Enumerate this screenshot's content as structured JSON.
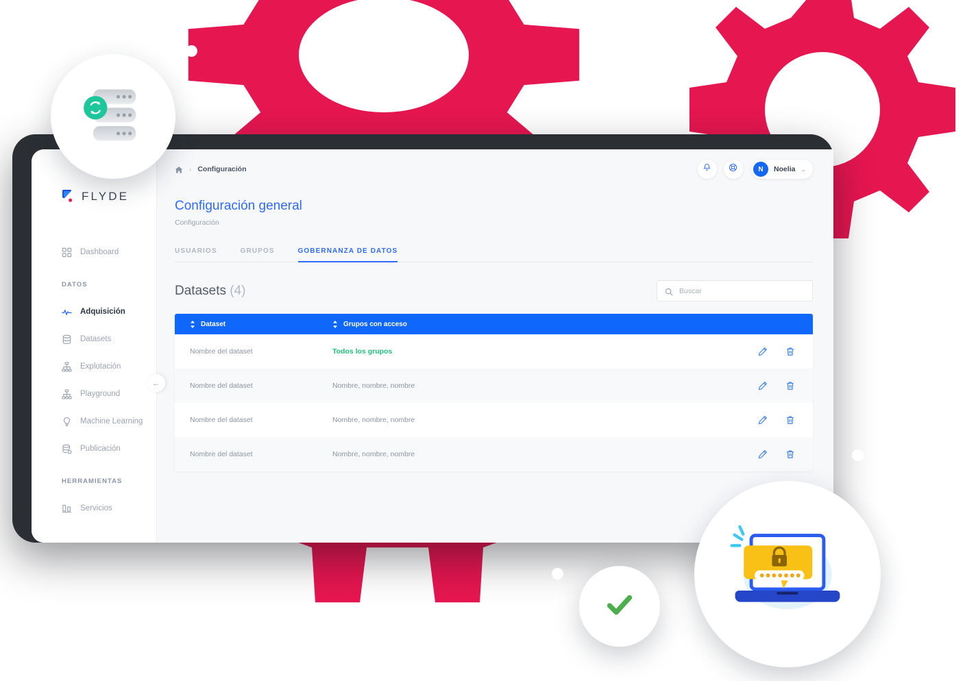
{
  "brand": {
    "name": "FLYDE",
    "accent_blue": "#2f6bff",
    "accent_pink": "#e61650",
    "accent_green": "#22c07a",
    "header_blue": "#0f67fb"
  },
  "sidebar": {
    "logo_label": "FLYDE",
    "items": [
      {
        "label": "Dashboard",
        "icon": "grid-icon",
        "active": false
      },
      {
        "label": "Adquisición",
        "icon": "pulse-icon",
        "active": true
      },
      {
        "label": "Datasets",
        "icon": "database-icon",
        "active": false
      },
      {
        "label": "Explotación",
        "icon": "sitemap-icon",
        "active": false
      },
      {
        "label": "Playground",
        "icon": "sitemap-icon",
        "active": false
      },
      {
        "label": "Machine Learning",
        "icon": "bulb-icon",
        "active": false
      },
      {
        "label": "Publicación",
        "icon": "database-upload-icon",
        "active": false
      },
      {
        "label": "Servicios",
        "icon": "columns-icon",
        "active": false
      }
    ],
    "section_datos": "DATOS",
    "section_herramientas": "HERRAMIENTAS",
    "collapse_label": "←"
  },
  "topbar": {
    "breadcrumb_home": "home-icon",
    "breadcrumb_separator": "›",
    "breadcrumb_current": "Configuración",
    "notifications_icon": "bell-icon",
    "help_icon": "lifebuoy-icon",
    "user_initial": "N",
    "user_name": "Noelia",
    "user_chevron": "⌄"
  },
  "page": {
    "title": "Configuración general",
    "subtitle": "Configuración"
  },
  "tabs": [
    {
      "label": "USUARIOS",
      "active": false
    },
    {
      "label": "GRUPOS",
      "active": false
    },
    {
      "label": "GOBERNANZA DE DATOS",
      "active": true
    }
  ],
  "section": {
    "title": "Datasets",
    "count": "(4)"
  },
  "search": {
    "placeholder": "Buscar",
    "value": "",
    "icon": "search-icon"
  },
  "table": {
    "columns": [
      {
        "label": "Dataset",
        "sortable": true
      },
      {
        "label": "Grupos con acceso",
        "sortable": true
      }
    ],
    "rows": [
      {
        "dataset": "Nombre del dataset",
        "grupos": "Todos los grupos",
        "highlight": true
      },
      {
        "dataset": "Nombre del dataset",
        "grupos": "Nombre, nombre, nombre",
        "highlight": false
      },
      {
        "dataset": "Nombre del dataset",
        "grupos": "Nombre, nombre, nombre",
        "highlight": false
      },
      {
        "dataset": "Nombre del dataset",
        "grupos": "Nombre, nombre, nombre",
        "highlight": false
      }
    ],
    "row_actions": [
      {
        "name": "edit-icon",
        "label": "Editar"
      },
      {
        "name": "delete-icon",
        "label": "Eliminar"
      }
    ]
  },
  "decorations": {
    "gears": [
      {
        "name": "gear-top-right",
        "color": "#e61650"
      },
      {
        "name": "gear-top-center",
        "color": "#e61650"
      },
      {
        "name": "gear-bottom",
        "color": "#e61650"
      }
    ],
    "badges": [
      {
        "name": "server-sync-badge",
        "icon": "server-stack-icon"
      },
      {
        "name": "password-laptop-badge",
        "icon": "laptop-password-icon"
      },
      {
        "name": "success-check-badge",
        "icon": "check-icon"
      }
    ],
    "dots": 3
  }
}
